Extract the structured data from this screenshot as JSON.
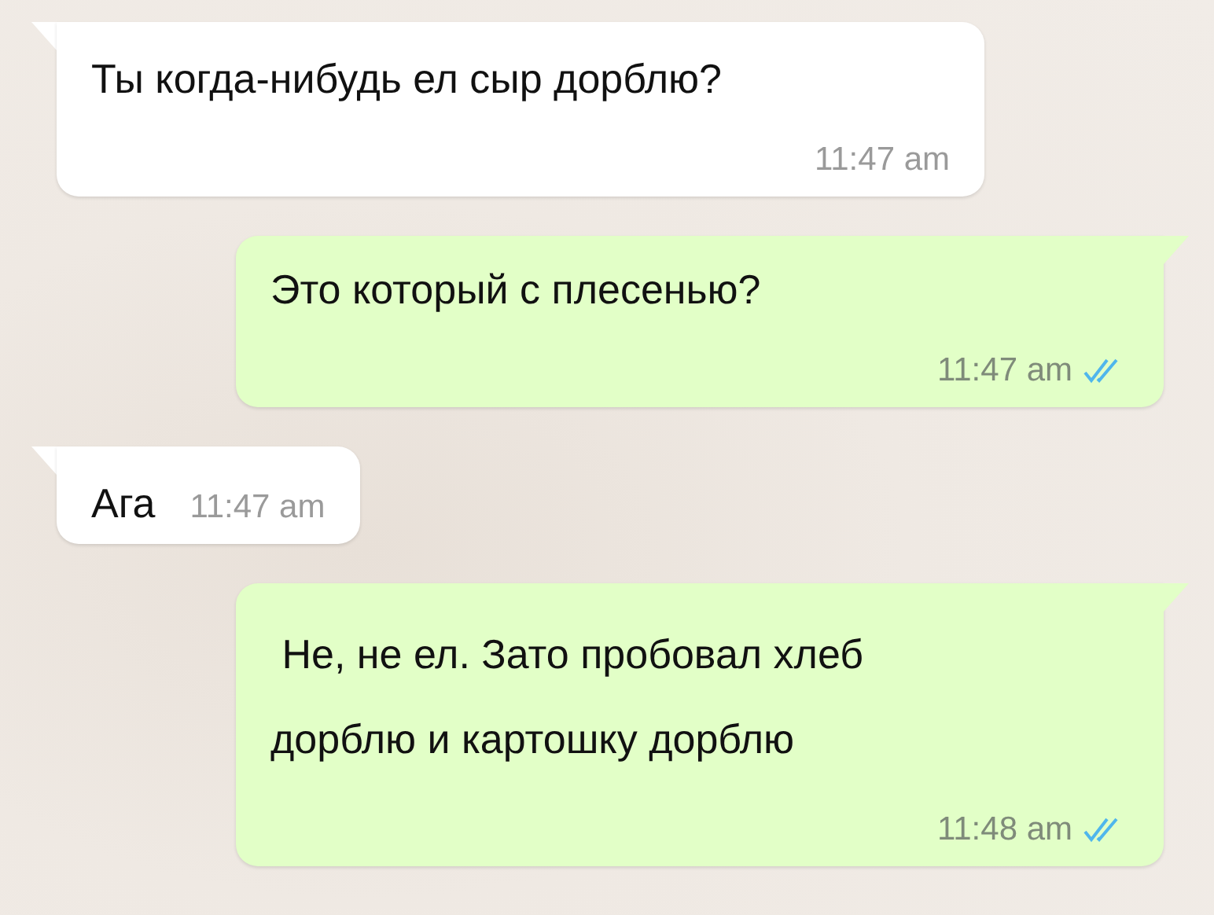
{
  "messages": [
    {
      "kind": "incoming",
      "text": "Ты когда-нибудь ел сыр дорблю?",
      "time": "11:47 am"
    },
    {
      "kind": "outgoing",
      "text": "Это который с плесенью?",
      "time": "11:47 am",
      "read": true
    },
    {
      "kind": "incoming",
      "text": "Ага",
      "time": "11:47 am"
    },
    {
      "kind": "outgoing",
      "text": " Не, не ел. Зато пробовал хлеб\nдорблю и картошку дорблю",
      "time": "11:48 am",
      "read": true
    }
  ]
}
